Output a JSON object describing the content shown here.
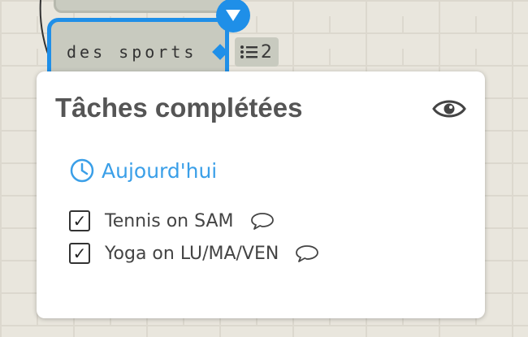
{
  "mindmap": {
    "selected_node": {
      "label": "des sports",
      "task_count": "2"
    }
  },
  "popover": {
    "title": "Tâches complétées",
    "section": {
      "label": "Aujourd'hui"
    },
    "tasks": [
      {
        "label": "Tennis on SAM",
        "checked": true,
        "check_glyph": "✓"
      },
      {
        "label": "Yoga on LU/MA/VEN",
        "checked": true,
        "check_glyph": "✓"
      }
    ]
  },
  "colors": {
    "accent": "#1f8fe8",
    "section_text": "#3a9fe8",
    "node_fill": "#c8cabf",
    "title_text": "#555555"
  },
  "icons": {
    "collapse": "triangle-down-icon",
    "task_list": "list-icon",
    "visibility": "eye-icon",
    "section": "clock-icon",
    "comment": "comment-icon"
  }
}
